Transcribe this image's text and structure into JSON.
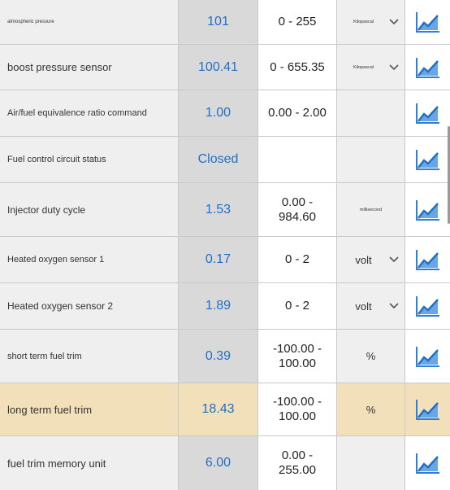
{
  "rows": [
    {
      "name": "atmospheric pressure",
      "value": "101",
      "range": "0 - 255",
      "unit": "Kilopascal",
      "unit_dropdown": true
    },
    {
      "name": "boost pressure sensor",
      "value": "100.41",
      "range": "0 - 655.35",
      "unit": "Kilopascal",
      "unit_dropdown": true
    },
    {
      "name": "Air/fuel equivalence ratio command",
      "value": "1.00",
      "range": "0.00 - 2.00",
      "unit": "",
      "unit_dropdown": false
    },
    {
      "name": "Fuel control circuit status",
      "value": "Closed",
      "range": "",
      "unit": "",
      "unit_dropdown": false
    },
    {
      "name": "Injector duty cycle",
      "value": "1.53",
      "range": "0.00 -\n984.60",
      "unit": "millisecond",
      "unit_dropdown": false
    },
    {
      "name": "Heated oxygen sensor 1",
      "value": "0.17",
      "range": "0 - 2",
      "unit": "volt",
      "unit_dropdown": true
    },
    {
      "name": "Heated oxygen sensor 2",
      "value": "1.89",
      "range": "0 - 2",
      "unit": "volt",
      "unit_dropdown": true
    },
    {
      "name": "short term fuel trim",
      "value": "0.39",
      "range": "-100.00 -\n100.00",
      "unit": "%",
      "unit_dropdown": false
    },
    {
      "name": "long term fuel trim",
      "value": "18.43",
      "range": "-100.00 -\n100.00",
      "unit": "%",
      "unit_dropdown": false,
      "highlighted": true
    },
    {
      "name": "fuel trim memory unit",
      "value": "6.00",
      "range": "0.00 -\n255.00",
      "unit": "",
      "unit_dropdown": false
    }
  ],
  "icons": {
    "graph": "line-graph-icon",
    "dropdown": "chevron-down-icon"
  },
  "colors": {
    "value_text": "#1f6fc9",
    "highlight_row": "#f2e0bb",
    "graph_icon": "#2f7fd6"
  }
}
